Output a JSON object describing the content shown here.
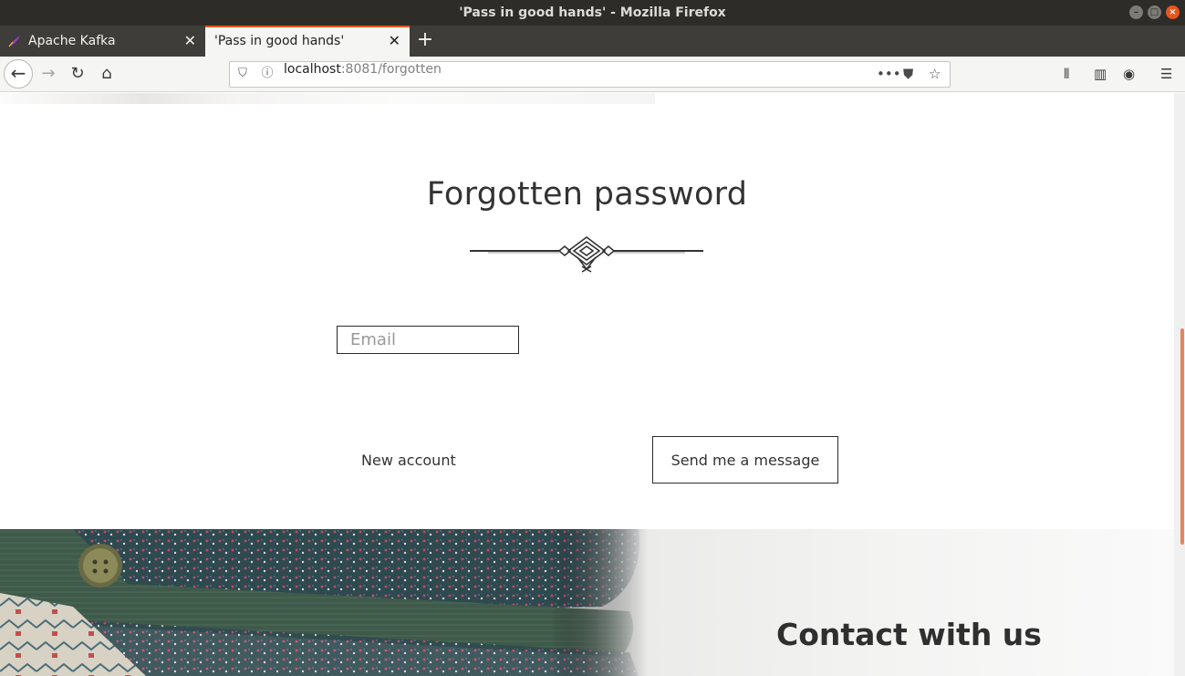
{
  "window": {
    "title": "'Pass in good hands' - Mozilla Firefox"
  },
  "tabs": [
    {
      "label": "Apache Kafka",
      "active": false
    },
    {
      "label": "'Pass in good hands'",
      "active": true
    }
  ],
  "urlbar": {
    "host": "localhost",
    "rest": ":8081/forgotten"
  },
  "page": {
    "title": "Forgotten password",
    "email_placeholder": "Email",
    "email_value": "",
    "new_account_label": "New account",
    "send_button_label": "Send me a message",
    "contact_heading": "Contact with us"
  },
  "colors": {
    "accent": "#e95420",
    "text": "#333333",
    "scroll_thumb": "#e7845a"
  },
  "icons": [
    "back-icon",
    "forward-icon",
    "reload-icon",
    "home-icon",
    "shield-icon",
    "info-icon",
    "more-icon",
    "pocket-icon",
    "bookmark-star-icon",
    "library-icon",
    "sidebar-icon",
    "account-icon",
    "menu-icon"
  ]
}
